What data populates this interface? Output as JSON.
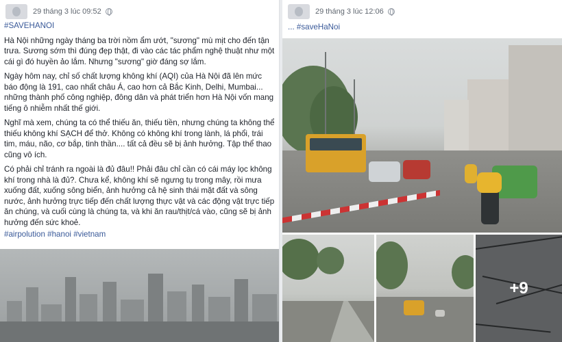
{
  "left_post": {
    "timestamp": "29 tháng 3 lúc 09:52",
    "hashtag": "#SAVEHANOI",
    "paragraphs": [
      "Hà Nội những ngày tháng ba trời nồm ẩm ướt, \"sương\" mù mịt cho đến tận trưa. Sương sớm thì đúng đẹp thật, đi vào các tác phẩm nghệ thuật như một cái gì đó huyền ảo lắm. Nhưng \"sương\" giờ đáng sợ lắm.",
      "Ngày hôm nay, chỉ số chất lượng không khí (AQI) của Hà Nội đã lên mức báo động là 191, cao nhất châu Á, cao hơn cả Bắc Kinh, Delhi, Mumbai... những thành phố công nghiệp, đông dân và phát triển hơn Hà Nội vốn mang tiếng ô nhiễm nhất thế giới.",
      "Nghĩ mà xem, chúng ta có thể thiếu ăn, thiếu tiền, nhưng chúng ta không thể thiếu không khí SẠCH để thở. Không có không khí trong lành, lá phổi, trái tim, máu, não, cơ bắp, tinh thần.... tất cả đều sẽ bị ảnh hưởng. Tập thể thao cũng vô ích.",
      "Có phải chỉ tránh ra ngoài là đủ đâu!! Phải đâu chỉ cần có cái máy lọc không khí trong nhà là đủ?. Chưa kể, không khí sẽ ngưng tụ trong mây, rồi mưa xuống đất, xuống sông biển, ảnh hưởng cả hệ sinh thái mặt đất và sông nước, ảnh hưởng trực tiếp đến chất lượng thực vật và các động vật trực tiếp ăn chúng, và cuối cùng là chúng ta, và khi ăn rau/thịt/cá vào, cũng sẽ bị ảnh hưởng đến sức khoẻ."
    ],
    "hashtags_footer": "#airpolution #hanoi #vietnam"
  },
  "right_post": {
    "timestamp": "29 tháng 3 lúc 12:06",
    "text": "... #saveHaNoi",
    "more_photos": "+9"
  },
  "colors": {
    "link": "#385898",
    "meta": "#606770"
  },
  "icons": [
    "globe-icon"
  ]
}
